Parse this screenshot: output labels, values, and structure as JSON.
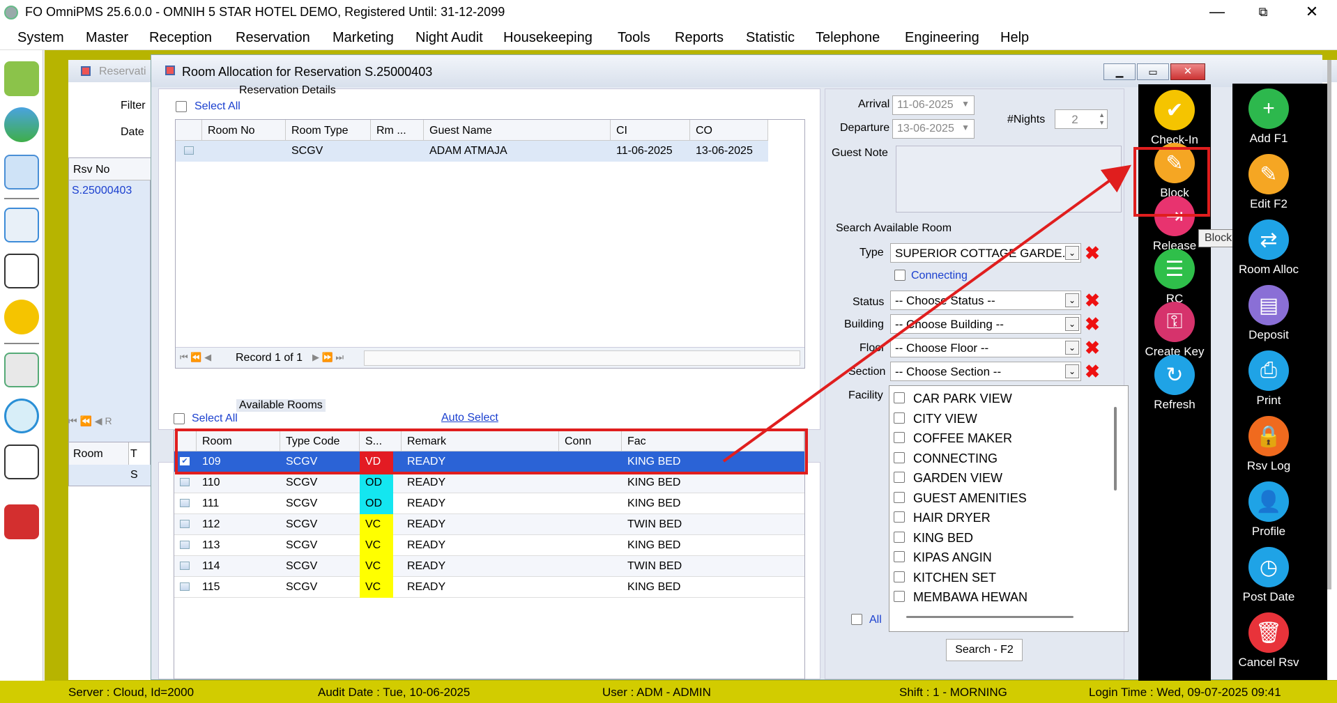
{
  "app": {
    "title": "FO OmniPMS 25.6.0.0 - OMNIH 5 STAR HOTEL DEMO, Registered Until: 31-12-2099"
  },
  "menu": [
    "System",
    "Master",
    "Reception",
    "Reservation",
    "Marketing",
    "Night Audit",
    "Housekeeping",
    "Tools",
    "Reports",
    "Statistic",
    "Telephone",
    "Engineering",
    "Help"
  ],
  "background_window": {
    "title": "Reservati",
    "filter_label": "Filter",
    "date_label": "Date",
    "rsv_no_header": "Rsv No",
    "rsv_no_value": "S.25000403",
    "room_header": "Room",
    "col_t": "T",
    "col_s": "S",
    "nav_r": "R"
  },
  "dialog": {
    "title": "Room Allocation for Reservation S.25000403",
    "reservation_details": {
      "group_label": "Reservation Details",
      "select_all": "Select All",
      "columns": [
        "Room No",
        "Room Type",
        "Rm ...",
        "Guest Name",
        "CI",
        "CO"
      ],
      "rows": [
        [
          "",
          "SCGV",
          "",
          "ADAM ATMAJA",
          "11-06-2025",
          "13-06-2025"
        ]
      ],
      "record_text": "Record 1 of 1"
    },
    "available_rooms": {
      "group_label": "Available Rooms",
      "select_all": "Select All",
      "auto_select": "Auto Select",
      "columns": [
        "Room",
        "Type Code",
        "S...",
        "Remark",
        "Conn",
        "Fac"
      ],
      "rows": [
        {
          "room": "109",
          "type": "SCGV",
          "status": "VD",
          "remark": "READY",
          "conn": "",
          "fac": "KING BED",
          "checked": true,
          "status_color": "#e31b23"
        },
        {
          "room": "110",
          "type": "SCGV",
          "status": "OD",
          "remark": "READY",
          "conn": "",
          "fac": "KING BED",
          "checked": false,
          "status_color": "#14e6f0"
        },
        {
          "room": "111",
          "type": "SCGV",
          "status": "OD",
          "remark": "READY",
          "conn": "",
          "fac": "KING BED",
          "checked": false,
          "status_color": "#14e6f0"
        },
        {
          "room": "112",
          "type": "SCGV",
          "status": "VC",
          "remark": "READY",
          "conn": "",
          "fac": "TWIN BED",
          "checked": false,
          "status_color": "#ffff00"
        },
        {
          "room": "113",
          "type": "SCGV",
          "status": "VC",
          "remark": "READY",
          "conn": "",
          "fac": "KING BED",
          "checked": false,
          "status_color": "#ffff00"
        },
        {
          "room": "114",
          "type": "SCGV",
          "status": "VC",
          "remark": "READY",
          "conn": "",
          "fac": "TWIN BED",
          "checked": false,
          "status_color": "#ffff00"
        },
        {
          "room": "115",
          "type": "SCGV",
          "status": "VC",
          "remark": "READY",
          "conn": "",
          "fac": "KING BED",
          "checked": false,
          "status_color": "#ffff00"
        }
      ]
    },
    "stay": {
      "arrival_label": "Arrival",
      "arrival_value": "11-06-2025",
      "departure_label": "Departure",
      "departure_value": "13-06-2025",
      "nights_label": "#Nights",
      "nights_value": "2",
      "guest_note_label": "Guest Note"
    },
    "search": {
      "group_label": "Search Available Room",
      "type_label": "Type",
      "type_value": "SUPERIOR COTTAGE GARDE...",
      "connecting_label": "Connecting",
      "status_label": "Status",
      "status_value": "-- Choose Status --",
      "building_label": "Building",
      "building_value": "-- Choose Building --",
      "floor_label": "Floor",
      "floor_value": "-- Choose Floor --",
      "section_label": "Section",
      "section_value": "-- Choose Section --",
      "facility_label": "Facility",
      "facilities": [
        "CAR PARK VIEW",
        "CITY VIEW",
        "COFFEE MAKER",
        "CONNECTING",
        "GARDEN VIEW",
        "GUEST AMENITIES",
        "HAIR DRYER",
        "KING BED",
        "KIPAS ANGIN",
        "KITCHEN SET",
        "MEMBAWA HEWAN"
      ],
      "all_label": "All",
      "search_button": "Search - F2"
    },
    "actions": [
      {
        "label": "Check-In",
        "icon": "check-in-icon",
        "color": "#f5c400"
      },
      {
        "label": "Block",
        "icon": "block-icon",
        "color": "#f5a623"
      },
      {
        "label": "Release",
        "icon": "release-icon",
        "color": "#e8336f"
      },
      {
        "label": "RC",
        "icon": "rc-icon",
        "color": "#2fbf4a"
      },
      {
        "label": "Create Key",
        "icon": "create-key-icon",
        "color": "#d6336c"
      },
      {
        "label": "Refresh",
        "icon": "refresh-icon",
        "color": "#1fa3e6"
      }
    ],
    "tooltip": "Block"
  },
  "main_actions": [
    {
      "label": "Add F1",
      "icon": "add-icon",
      "color": "#2db84d"
    },
    {
      "label": "Edit F2",
      "icon": "edit-icon",
      "color": "#f5a623"
    },
    {
      "label": "Room Alloc",
      "icon": "room-alloc-icon",
      "color": "#1fa3e6"
    },
    {
      "label": "Deposit",
      "icon": "deposit-icon",
      "color": "#8a6fd6"
    },
    {
      "label": "Print",
      "icon": "print-icon",
      "color": "#1fa3e6"
    },
    {
      "label": "Rsv Log",
      "icon": "rsv-log-icon",
      "color": "#f06a1e"
    },
    {
      "label": "Profile",
      "icon": "profile-icon",
      "color": "#1fa3e6"
    },
    {
      "label": "Post Date",
      "icon": "post-date-icon",
      "color": "#1fa3e6"
    },
    {
      "label": "Cancel Rsv",
      "icon": "cancel-rsv-icon",
      "color": "#e8333a"
    }
  ],
  "status": {
    "server": "Server : Cloud, Id=2000",
    "audit_date": "Audit Date : Tue, 10-06-2025",
    "user": "User : ADM - ADMIN",
    "shift": "Shift : 1 - MORNING",
    "login": "Login Time : Wed, 09-07-2025 09:41"
  },
  "colors": {
    "highlight": "#e01e1e",
    "selected_row": "#2b63d6",
    "status_bar": "#d2cc00"
  }
}
